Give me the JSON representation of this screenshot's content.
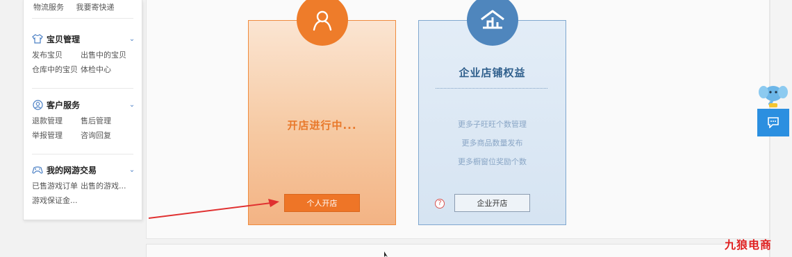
{
  "sidebar": {
    "top_links": [
      "物流服务",
      "我要寄快递"
    ],
    "sections": [
      {
        "title": "宝贝管理",
        "icon": "tshirt-icon",
        "rows": [
          [
            "发布宝贝",
            "出售中的宝贝"
          ],
          [
            "仓库中的宝贝",
            "体检中心"
          ]
        ]
      },
      {
        "title": "客户服务",
        "icon": "user-circle-icon",
        "rows": [
          [
            "退款管理",
            "售后管理"
          ],
          [
            "举报管理",
            "咨询回复"
          ]
        ]
      },
      {
        "title": "我的网游交易",
        "icon": "gamepad-icon",
        "rows": [
          [
            "已售游戏订单",
            "出售的游戏..."
          ],
          [
            "游戏保证金...",
            ""
          ]
        ]
      }
    ]
  },
  "personal_card": {
    "status": "开店进行中...",
    "button_label": "个人开店",
    "icon": "person-icon",
    "accent_color": "#ee7c2a"
  },
  "enterprise_card": {
    "title": "企业店铺权益",
    "features": [
      "更多子旺旺个数管理",
      "更多商品数量发布",
      "更多橱窗位奖励个数"
    ],
    "button_label": "企业开店",
    "help_symbol": "?",
    "icon": "enterprise-icon",
    "accent_color": "#4f86bd"
  },
  "widgets": {
    "mascot_icon": "elephant-mascot-icon",
    "chat_icon": "chat-bubble-icon"
  },
  "watermark": "九狼电商"
}
